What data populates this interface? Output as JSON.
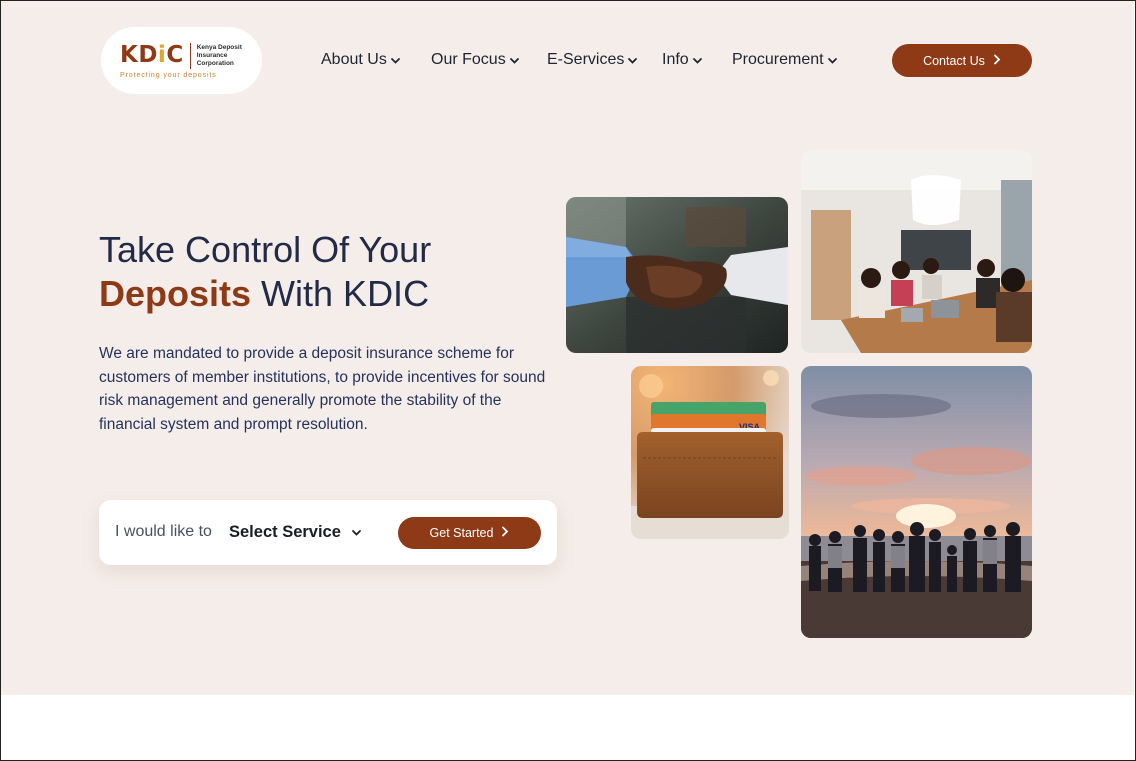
{
  "logo": {
    "mark_start": "KD",
    "mark_dot_letter": "i",
    "mark_end": "C",
    "name": "Kenya Deposit Insurance Corporation",
    "tagline": "Protecting your deposits"
  },
  "nav": {
    "items": [
      {
        "label": "About Us"
      },
      {
        "label": "Our Focus"
      },
      {
        "label": "E-Services"
      },
      {
        "label": "Info"
      },
      {
        "label": "Procurement"
      }
    ],
    "contact_label": "Contact Us"
  },
  "hero": {
    "title_line1": "Take Control Of Your",
    "title_accent": "Deposits",
    "title_rest": " With KDIC",
    "description": "We are mandated to provide a deposit insurance scheme for customers of member institutions, to provide incentives for sound risk management and generally promote the stability of the financial system and prompt resolution."
  },
  "service": {
    "prefix": "I would like to",
    "selected": "Select Service",
    "button_label": "Get Started"
  },
  "photos": [
    {
      "subject": "handshake"
    },
    {
      "subject": "office meeting"
    },
    {
      "subject": "wallet with cards",
      "card_brand": "VISA"
    },
    {
      "subject": "people on beach at sunset"
    }
  ],
  "colors": {
    "brand": "#8e3a17",
    "hero_bg": "#f5ede9",
    "logo_dot": "#e2a531"
  }
}
